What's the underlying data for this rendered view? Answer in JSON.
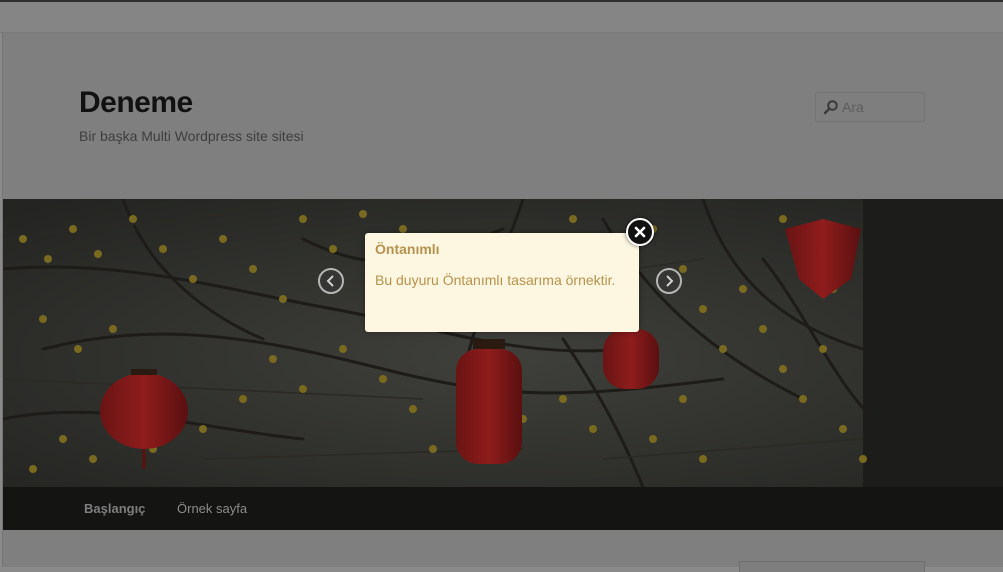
{
  "site": {
    "title": "Deneme",
    "description": "Bir başka Multi Wordpress site sitesi"
  },
  "search": {
    "placeholder": "Ara",
    "icon": "search-icon"
  },
  "nav": {
    "items": [
      {
        "label": "Başlangıç",
        "current": true
      },
      {
        "label": "Örnek sayfa",
        "current": false
      }
    ]
  },
  "notice": {
    "title": "Öntanımlı",
    "text": "Bu duyuru Öntanımlı tasarıma örnektir.",
    "close_icon": "close-icon",
    "prev_icon": "chevron-left-icon",
    "next_icon": "chevron-right-icon"
  },
  "colors": {
    "overlay": "#7f7f7f",
    "notice_bg": "#fdf6e0",
    "notice_text": "#b8924d",
    "nav_bg": "#141412"
  }
}
